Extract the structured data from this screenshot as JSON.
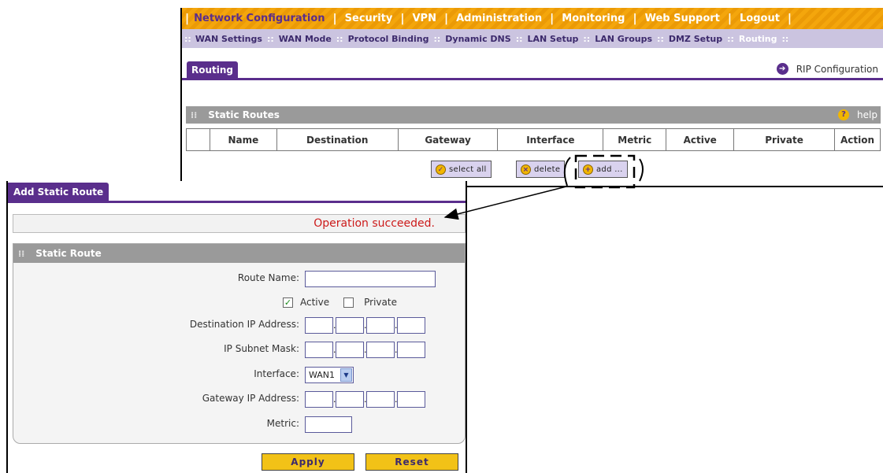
{
  "primary_nav": [
    "Network Configuration",
    "Security",
    "VPN",
    "Administration",
    "Monitoring",
    "Web Support",
    "Logout"
  ],
  "primary_nav_separator": "|",
  "secondary_nav": [
    "WAN Settings",
    "WAN Mode",
    "Protocol Binding",
    "Dynamic DNS",
    "LAN Setup",
    "LAN Groups",
    "DMZ Setup",
    "Routing"
  ],
  "secondary_nav_separator": "::",
  "routing_tab": "Routing",
  "rip_link": "RIP Configuration",
  "static_routes": {
    "title": "Static Routes",
    "help": "help",
    "columns": [
      "",
      "Name",
      "Destination",
      "Gateway",
      "Interface",
      "Metric",
      "Active",
      "Private",
      "Action"
    ]
  },
  "toolbar": {
    "select_all": "select all",
    "delete": "delete",
    "add": "add ..."
  },
  "add_route": {
    "tab": "Add Static Route",
    "status": "Operation succeeded.",
    "section_title": "Static Route",
    "route_name_label": "Route Name:",
    "active_label": "Active",
    "active_checked": true,
    "private_label": "Private",
    "private_checked": false,
    "destination_ip_label": "Destination IP Address:",
    "subnet_mask_label": "IP Subnet Mask:",
    "interface_label": "Interface:",
    "interface_value": "WAN1",
    "gateway_ip_label": "Gateway IP Address:",
    "metric_label": "Metric:",
    "apply": "Apply",
    "reset": "Reset"
  },
  "colors": {
    "nav_orange": "#f4a60c",
    "accent_purple": "#5a2e8c",
    "subnav_lavender": "#cbc4e0",
    "section_gray": "#9a9a9a",
    "status_red": "#cc1a1a",
    "button_yellow": "#f2c217"
  }
}
